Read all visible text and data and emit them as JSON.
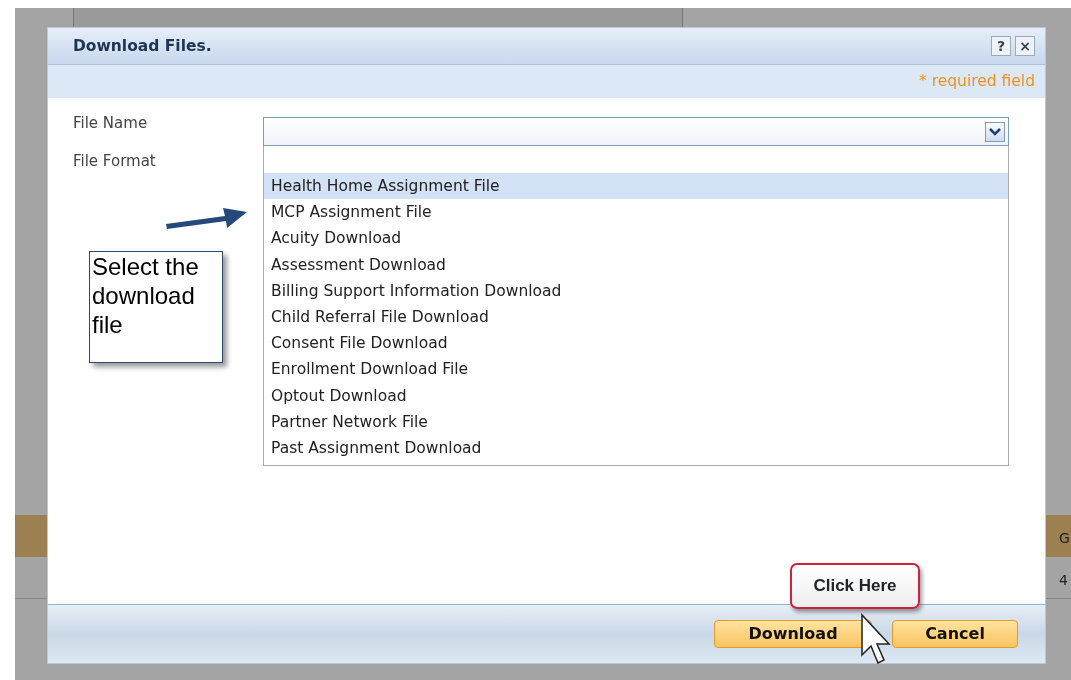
{
  "background": {
    "column_header": "G",
    "cell": "4"
  },
  "dialog": {
    "title": "Download Files.",
    "help": "?",
    "close": "×",
    "required_note": "* required field",
    "fields": [
      {
        "label": "File Name",
        "dropdown": {
          "expanded": true,
          "blank_first_option": true,
          "options": [
            {
              "label": "Health Home Assignment File",
              "selected": true
            },
            {
              "label": "MCP Assignment File",
              "selected": false
            },
            {
              "label": "Acuity Download",
              "selected": false
            },
            {
              "label": "Assessment Download",
              "selected": false
            },
            {
              "label": "Billing Support Information Download",
              "selected": false
            },
            {
              "label": "Child Referral File Download",
              "selected": false
            },
            {
              "label": "Consent File Download",
              "selected": false
            },
            {
              "label": "Enrollment Download File",
              "selected": false
            },
            {
              "label": "Optout Download",
              "selected": false
            },
            {
              "label": "Partner Network File",
              "selected": false
            },
            {
              "label": "Past Assignment Download",
              "selected": false
            }
          ]
        }
      },
      {
        "label": "File Format"
      }
    ],
    "buttons": [
      {
        "label": "Download"
      },
      {
        "label": "Cancel"
      }
    ]
  },
  "annotations": {
    "note": "Select the download file",
    "callout": "Click Here"
  }
}
